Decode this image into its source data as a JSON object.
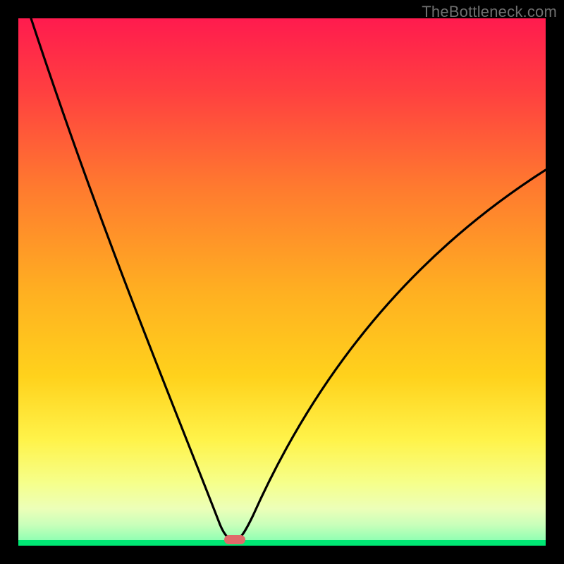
{
  "watermark": "TheBottleneck.com",
  "chart_data": {
    "type": "line",
    "title": "",
    "xlabel": "",
    "ylabel": "",
    "xlim": [
      0,
      100
    ],
    "ylim": [
      0,
      100
    ],
    "background_gradient": {
      "top_color": "#ff1b4e",
      "mid_colors": [
        "#ff7a2f",
        "#ffd21c",
        "#fff34a",
        "#f6ff8a"
      ],
      "bottom_band_color": "#00e874"
    },
    "curve": {
      "description": "V-shaped bottleneck curve; vertex near x≈40, y≈0; left branch rises steeply toward top-left edge; right branch rises with decreasing slope toward upper-right area.",
      "vertex": {
        "x": 40,
        "y": 1
      },
      "left_top": {
        "x": 2,
        "y": 100
      },
      "right_end": {
        "x": 100,
        "y": 70
      }
    },
    "marker": {
      "description": "small rounded red-pink pill at curve vertex",
      "x": 40,
      "y": 1,
      "color": "#e06a6a"
    }
  }
}
